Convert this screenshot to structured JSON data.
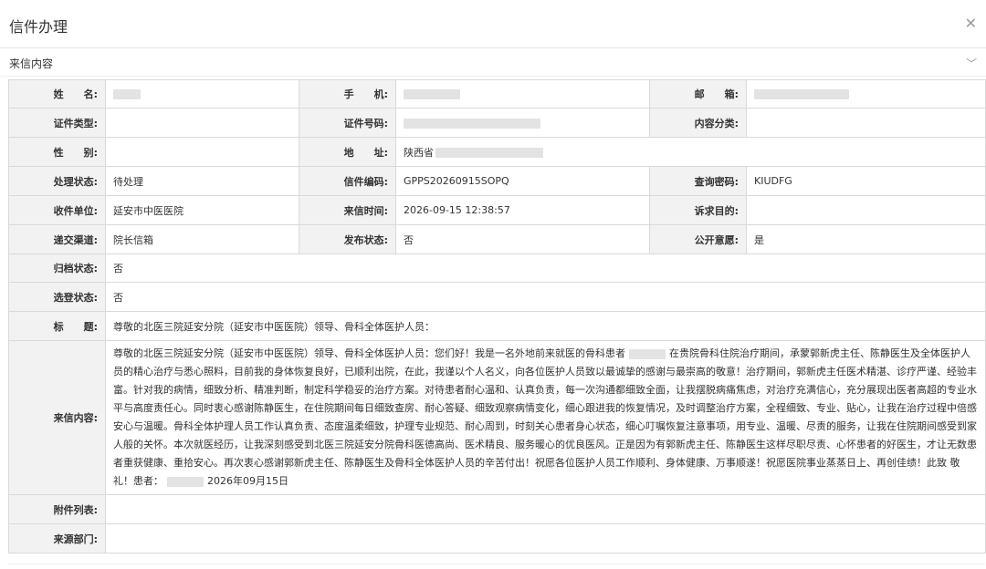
{
  "dialog": {
    "title": "信件办理",
    "close_icon": "close-icon"
  },
  "section": {
    "label": "来信内容",
    "toggle_icon": "chevron-down-icon"
  },
  "form": {
    "name_label": "姓　　名:",
    "phone_label": "手　　机:",
    "email_label": "邮　　箱:",
    "id_type_label": "证件类型:",
    "id_number_label": "证件号码:",
    "category_label": "内容分类:",
    "gender_label": "性　　别:",
    "address_label": "地　　址:",
    "address_value": "陕西省",
    "status_label": "处理状态:",
    "status_value": "待处理",
    "code_label": "信件编码:",
    "code_value": "GPPS20260915SOPQ",
    "query_pwd_label": "查询密码:",
    "query_pwd_value": "KIUDFG",
    "receiver_label": "收件单位:",
    "receiver_value": "延安市中医医院",
    "time_label": "来信时间:",
    "time_value": "2026-09-15 12:38:57",
    "purpose_label": "诉求目的:",
    "channel_label": "递交渠道:",
    "channel_value": "院长信箱",
    "publish_label": "发布状态:",
    "publish_value": "否",
    "public_label": "公开意愿:",
    "public_value": "是",
    "archive_label": "归档状态:",
    "archive_value": "否",
    "select_label": "选登状态:",
    "select_value": "否",
    "subject_label": "标　　题:",
    "subject_value": "尊敬的北医三院延安分院（延安市中医医院）领导、骨科全体医护人员：",
    "content_label": "来信内容:",
    "content_part1": "尊敬的北医三院延安分院（延安市中医医院）领导、骨科全体医护人员：您们好！我是一名外地前来就医的骨科患者",
    "content_part2": "在贵院骨科住院治疗期间，承蒙郭新虎主任、陈静医生及全体医护人员的精心治疗与悉心照料，目前我的身体恢复良好，已顺利出院，在此，我谨以个人名义，向各位医护人员致以最诚挚的感谢与最崇高的敬意！治疗期间，郭新虎主任医术精湛、诊疗严谨、经验丰富。针对我的病情，细致分析、精准判断，制定科学稳妥的治疗方案。对待患者耐心温和、认真负责，每一次沟通都细致全面，让我摆脱病痛焦虑，对治疗充满信心，充分展现出医者高超的专业水平与高度责任心。同时衷心感谢陈静医生，在住院期间每日细致查房、耐心答疑、细致观察病情变化，细心跟进我的恢复情况，及时调整治疗方案，全程细致、专业、贴心，让我在治疗过程中倍感安心与温暖。骨科全体护理人员工作认真负责、态度温柔细致，护理专业规范、耐心周到，时刻关心患者身心状态，细心叮嘱恢复注意事项，用专业、温暖、尽责的服务，让我在住院期间感受到家人般的关怀。本次就医经历，让我深刻感受到北医三院延安分院骨科医德高尚、医术精良、服务暖心的优良医风。正是因为有郭新虎主任、陈静医生这样尽职尽责、心怀患者的好医生，才让无数患者重获健康、重拾安心。再次衷心感谢郭新虎主任、陈静医生及骨科全体医护人员的辛苦付出！祝愿各位医护人员工作顺利、身体健康、万事顺遂！祝愿医院事业蒸蒸日上、再创佳绩！此致 敬礼！患者：",
    "content_part3": "2026年09月15日",
    "attachment_label": "附件列表:",
    "source_label": "来源部门:"
  }
}
